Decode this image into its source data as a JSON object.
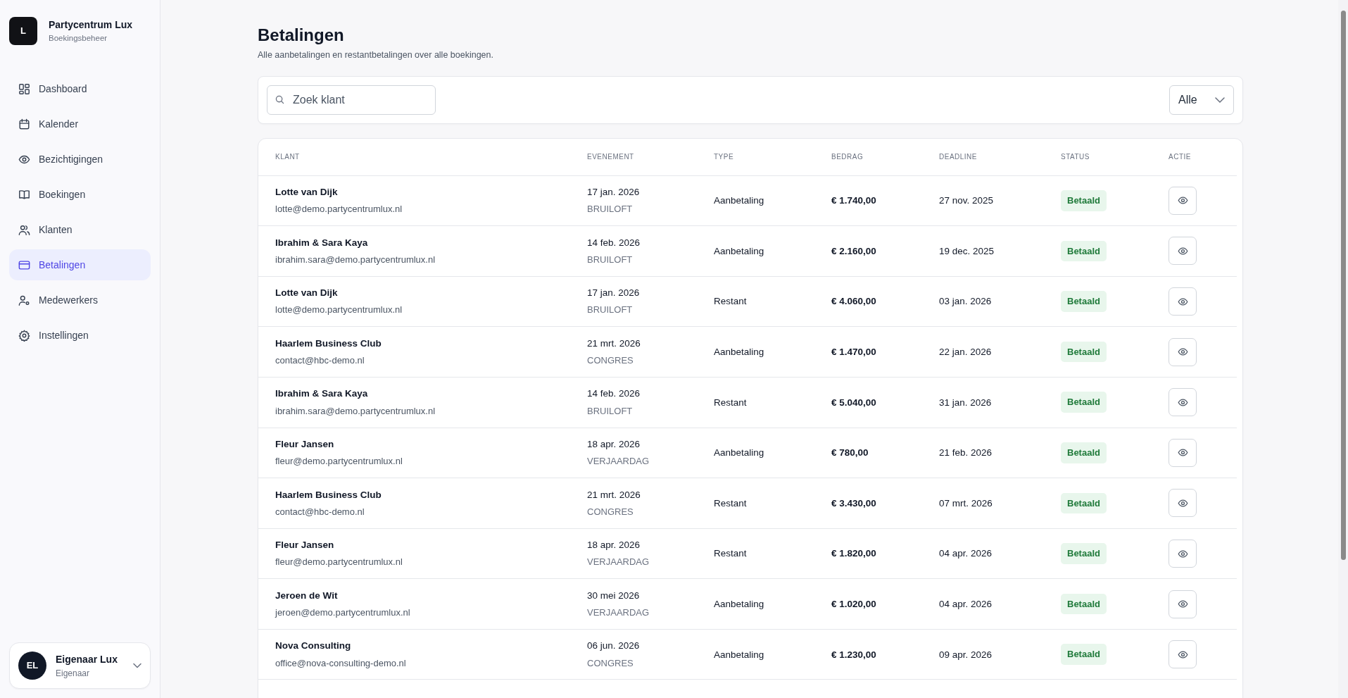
{
  "brand": {
    "logo": "L",
    "title": "Partycentrum Lux",
    "subtitle": "Boekingsbeheer"
  },
  "sidebar": {
    "items": [
      {
        "label": "Dashboard",
        "selected": false
      },
      {
        "label": "Kalender",
        "selected": false
      },
      {
        "label": "Bezichtigingen",
        "selected": false
      },
      {
        "label": "Boekingen",
        "selected": false
      },
      {
        "label": "Klanten",
        "selected": false
      },
      {
        "label": "Betalingen",
        "selected": true
      },
      {
        "label": "Medewerkers",
        "selected": false
      },
      {
        "label": "Instellingen",
        "selected": false
      }
    ]
  },
  "user": {
    "initials": "EL",
    "name": "Eigenaar Lux",
    "role": "Eigenaar"
  },
  "page": {
    "title": "Betalingen",
    "subtitle": "Alle aanbetalingen en restantbetalingen over alle boekingen."
  },
  "filters": {
    "search": {
      "placeholder": "Zoek klant"
    },
    "status_select": {
      "value": "Alle"
    }
  },
  "table": {
    "columns": [
      "KLANT",
      "EVENEMENT",
      "TYPE",
      "BEDRAG",
      "DEADLINE",
      "STATUS",
      "ACTIE"
    ],
    "rows": [
      {
        "client": "Lotte van Dijk",
        "email": "lotte@demo.partycentrumlux.nl",
        "event_date": "17 jan. 2026",
        "event_type": "BRUILOFT",
        "type": "Aanbetaling",
        "amount": "€ 1.740,00",
        "deadline": "27 nov. 2025",
        "status": "Betaald"
      },
      {
        "client": "Ibrahim & Sara Kaya",
        "email": "ibrahim.sara@demo.partycentrumlux.nl",
        "event_date": "14 feb. 2026",
        "event_type": "BRUILOFT",
        "type": "Aanbetaling",
        "amount": "€ 2.160,00",
        "deadline": "19 dec. 2025",
        "status": "Betaald"
      },
      {
        "client": "Lotte van Dijk",
        "email": "lotte@demo.partycentrumlux.nl",
        "event_date": "17 jan. 2026",
        "event_type": "BRUILOFT",
        "type": "Restant",
        "amount": "€ 4.060,00",
        "deadline": "03 jan. 2026",
        "status": "Betaald"
      },
      {
        "client": "Haarlem Business Club",
        "email": "contact@hbc-demo.nl",
        "event_date": "21 mrt. 2026",
        "event_type": "CONGRES",
        "type": "Aanbetaling",
        "amount": "€ 1.470,00",
        "deadline": "22 jan. 2026",
        "status": "Betaald"
      },
      {
        "client": "Ibrahim & Sara Kaya",
        "email": "ibrahim.sara@demo.partycentrumlux.nl",
        "event_date": "14 feb. 2026",
        "event_type": "BRUILOFT",
        "type": "Restant",
        "amount": "€ 5.040,00",
        "deadline": "31 jan. 2026",
        "status": "Betaald"
      },
      {
        "client": "Fleur Jansen",
        "email": "fleur@demo.partycentrumlux.nl",
        "event_date": "18 apr. 2026",
        "event_type": "VERJAARDAG",
        "type": "Aanbetaling",
        "amount": "€ 780,00",
        "deadline": "21 feb. 2026",
        "status": "Betaald"
      },
      {
        "client": "Haarlem Business Club",
        "email": "contact@hbc-demo.nl",
        "event_date": "21 mrt. 2026",
        "event_type": "CONGRES",
        "type": "Restant",
        "amount": "€ 3.430,00",
        "deadline": "07 mrt. 2026",
        "status": "Betaald"
      },
      {
        "client": "Fleur Jansen",
        "email": "fleur@demo.partycentrumlux.nl",
        "event_date": "18 apr. 2026",
        "event_type": "VERJAARDAG",
        "type": "Restant",
        "amount": "€ 1.820,00",
        "deadline": "04 apr. 2026",
        "status": "Betaald"
      },
      {
        "client": "Jeroen de Wit",
        "email": "jeroen@demo.partycentrumlux.nl",
        "event_date": "30 mei 2026",
        "event_type": "VERJAARDAG",
        "type": "Aanbetaling",
        "amount": "€ 1.020,00",
        "deadline": "04 apr. 2026",
        "status": "Betaald"
      },
      {
        "client": "Nova Consulting",
        "email": "office@nova-consulting-demo.nl",
        "event_date": "06 jun. 2026",
        "event_type": "CONGRES",
        "type": "Aanbetaling",
        "amount": "€ 1.230,00",
        "deadline": "09 apr. 2026",
        "status": "Betaald"
      }
    ]
  }
}
